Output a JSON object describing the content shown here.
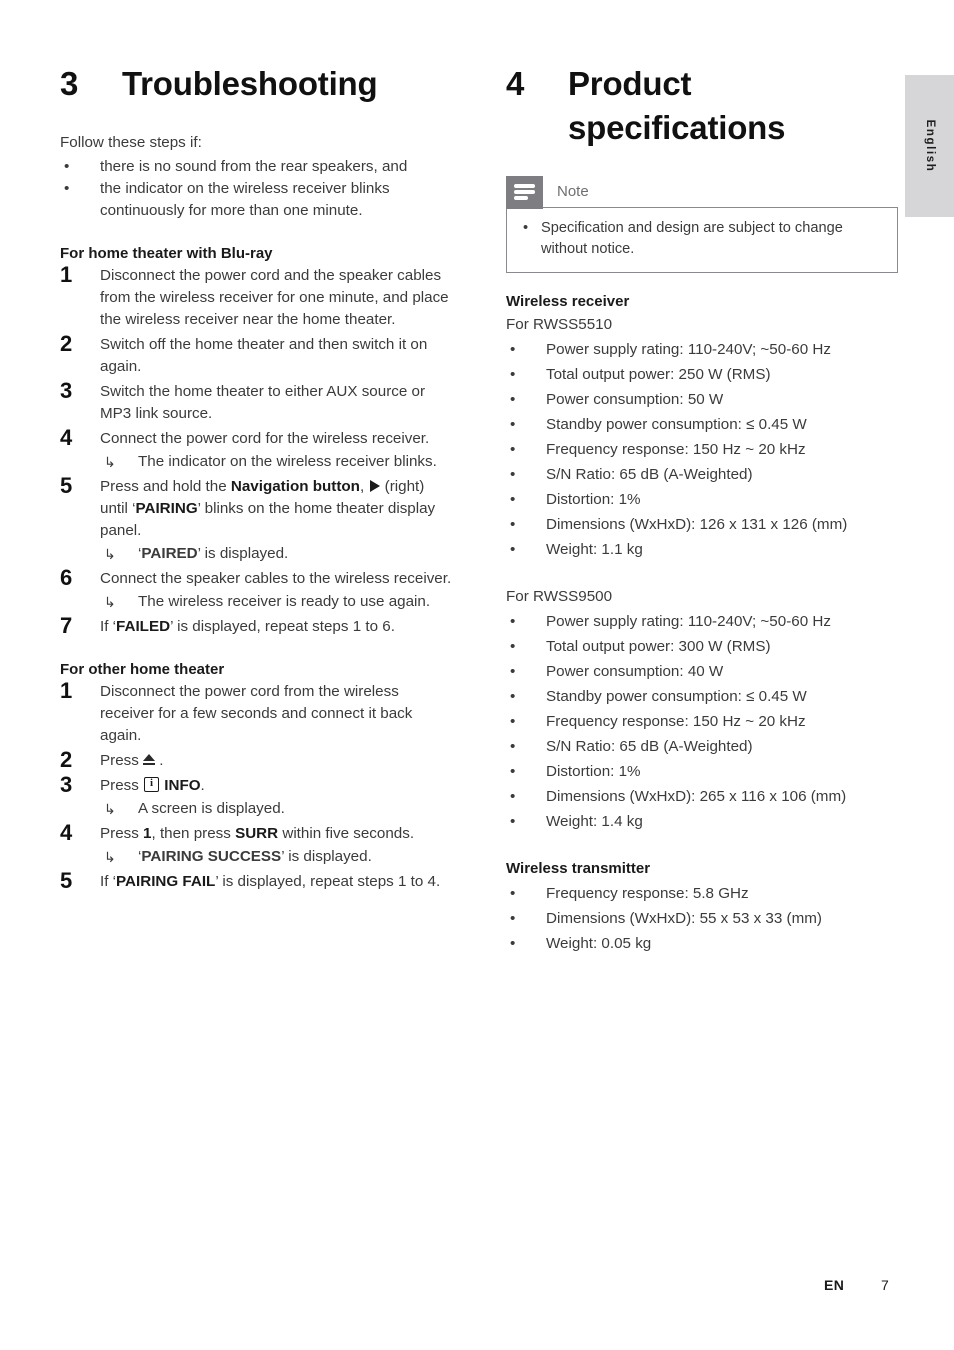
{
  "language_tab": {
    "label": "English"
  },
  "footer": {
    "edition": "EN",
    "page": "7"
  },
  "left_column": {
    "chapter": {
      "number": "3",
      "title": "Troubleshooting"
    },
    "intro": "Follow these steps if:",
    "intro_bullets": [
      "there is no sound from the rear speakers, and",
      "the indicator on the wireless receiver blinks continuously for more than one minute."
    ],
    "section_bluray": {
      "heading": "For home theater with Blu-ray",
      "steps": [
        {
          "number": "1",
          "text": "Disconnect the power cord and the speaker cables from the wireless receiver for one minute, and place the wireless receiver near the home theater."
        },
        {
          "number": "2",
          "text": "Switch off the home theater and then switch it on again."
        },
        {
          "number": "3",
          "text": "Switch the home theater to either AUX source or MP3 link source."
        },
        {
          "number": "4",
          "text": "Connect the power cord for the wireless receiver.",
          "result": "The indicator on the wireless receiver blinks."
        },
        {
          "number": "5",
          "text_pre": "Press and hold the ",
          "text_bold": "Navigation button",
          "text_mid": ", ",
          "glyph": "triangle-right-icon",
          "text_post_a": " (right) until ‘",
          "text_bold_b": "PAIRING",
          "text_post_b": "’ blinks on the home theater display panel.",
          "result_pre": "‘",
          "result_bold": "PAIRED",
          "result_post": "’ is displayed."
        },
        {
          "number": "6",
          "text": "Connect the speaker cables to the wireless receiver.",
          "result": "The wireless receiver is ready to use again."
        },
        {
          "number": "7",
          "text_pre": "If ‘",
          "text_bold": "FAILED",
          "text_post": "’ is displayed, repeat steps 1 to 6."
        }
      ]
    },
    "section_other": {
      "heading": "For other home theater",
      "steps": [
        {
          "number": "1",
          "text": "Disconnect the power cord from the wireless receiver for a few seconds and connect it back again."
        },
        {
          "number": "2",
          "text_pre": "Press ",
          "glyph": "eject-icon",
          "text_post": " ."
        },
        {
          "number": "3",
          "text_pre": "Press ",
          "glyph": "info-icon",
          "text_bold": " INFO",
          "text_post": ".",
          "result": "A screen is displayed."
        },
        {
          "number": "4",
          "text_pre": "Press ",
          "text_bold": "1",
          "text_mid": ", then press ",
          "text_bold_b": "SURR",
          "text_post": " within five seconds.",
          "result_pre": "‘",
          "result_bold": "PAIRING SUCCESS",
          "result_post": "’ is displayed."
        },
        {
          "number": "5",
          "text_pre": "If ‘",
          "text_bold": "PAIRING FAIL",
          "text_post": "’ is displayed, repeat steps 1 to 4."
        }
      ]
    }
  },
  "right_column": {
    "chapter": {
      "number": "4",
      "title_line1": "Product",
      "title_line2": "specifications"
    },
    "note": {
      "icon_name": "note-lines-icon",
      "title": "Note",
      "items": [
        "Specification and design are subject to change without notice."
      ]
    },
    "wireless_receiver": {
      "heading": "Wireless receiver",
      "models": [
        {
          "label": "For RWSS5510",
          "specs": [
            "Power supply rating: 110-240V; ~50-60 Hz",
            "Total output power: 250 W (RMS)",
            "Power consumption: 50 W",
            "Standby power consumption: ≤ 0.45 W",
            "Frequency response: 150 Hz ~ 20 kHz",
            "S/N Ratio: 65 dB (A-Weighted)",
            "Distortion: 1%",
            "Dimensions (WxHxD): 126 x 131 x 126 (mm)",
            "Weight: 1.1 kg"
          ]
        },
        {
          "label": "For RWSS9500",
          "specs": [
            "Power supply rating: 110-240V; ~50-60 Hz",
            "Total output power: 300 W (RMS)",
            "Power consumption: 40 W",
            "Standby power consumption: ≤ 0.45 W",
            "Frequency response: 150 Hz ~ 20 kHz",
            "S/N Ratio: 65 dB (A-Weighted)",
            "Distortion: 1%",
            "Dimensions (WxHxD): 265 x 116 x 106 (mm)",
            "Weight: 1.4 kg"
          ]
        }
      ]
    },
    "wireless_transmitter": {
      "heading": "Wireless transmitter",
      "specs": [
        "Frequency response: 5.8 GHz",
        "Dimensions (WxHxD): 55 x 53 x 33 (mm)",
        "Weight: 0.05 kg"
      ]
    }
  },
  "symbols": {
    "bullet": "•",
    "arrow": "↳"
  }
}
